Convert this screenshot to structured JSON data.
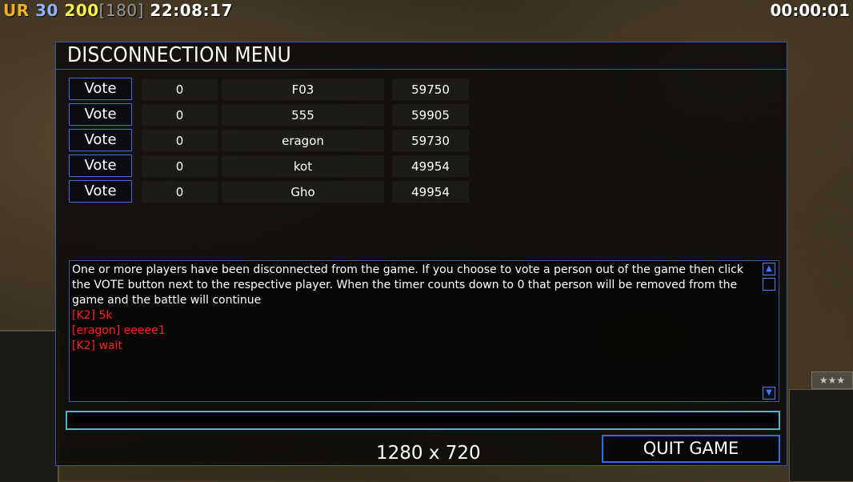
{
  "hud": {
    "faction": "UR",
    "level": "30",
    "power": "200",
    "power_cap": "[180]",
    "clock": "22:08:17",
    "timer": "00:00:01"
  },
  "menu": {
    "title": "DISCONNECTION MENU",
    "vote_label": "Vote",
    "players": [
      {
        "count": "0",
        "name": "F03",
        "id": "59750"
      },
      {
        "count": "0",
        "name": "555",
        "id": "59905"
      },
      {
        "count": "0",
        "name": "eragon",
        "id": "59730"
      },
      {
        "count": "0",
        "name": "kot",
        "id": "49954"
      },
      {
        "count": "0",
        "name": "Gho",
        "id": "49954"
      }
    ],
    "info_text": "One or more players have been disconnected from the game. If you choose to vote a person out of the game then click the VOTE button next to the respective player. When the timer counts down to 0 that person will be removed from the game and the battle will continue",
    "chat_lines": [
      "[K2] 5k",
      "[eragon] eeeee1",
      "[K2] wait"
    ],
    "chat_input_value": "",
    "resolution": "1280 x 720",
    "quit_label": "QUIT GAME"
  },
  "side": {
    "rank_stars": "★★★"
  },
  "colors": {
    "accent_blue": "#3e6fe0",
    "chat_red": "#ff2020",
    "input_cyan": "#4fb4cf"
  }
}
